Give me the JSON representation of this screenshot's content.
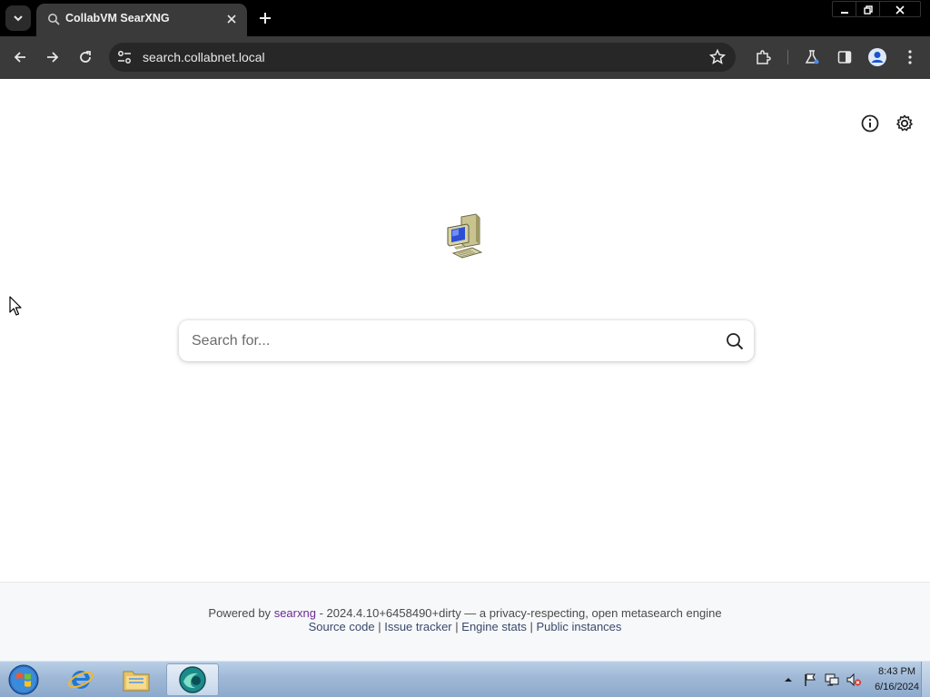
{
  "browser": {
    "tab": {
      "title": "CollabVM SearXNG"
    },
    "address": {
      "url": "search.collabnet.local"
    }
  },
  "page": {
    "search": {
      "placeholder": "Search for..."
    },
    "footer": {
      "powered_prefix": "Powered by",
      "searxng_link": "searxng",
      "version_text": "- 2024.4.10+6458490+dirty — a privacy-respecting, open metasearch engine",
      "links": [
        "Source code",
        "Issue tracker",
        "Engine stats",
        "Public instances"
      ],
      "separator": "|"
    }
  },
  "taskbar": {
    "clock": {
      "time": "8:43 PM",
      "date": "6/16/2024"
    },
    "apps": [
      "internet-explorer-icon",
      "file-explorer-icon",
      "browser-icon"
    ]
  },
  "colors": {
    "tab_bar": "#000000",
    "toolbar": "#3a3a3a",
    "omnibox": "#272727",
    "page_bg": "#ffffff",
    "footer_bg": "#f7f8fa",
    "link_purple": "#6b2b8f",
    "taskbar": "#9fb8d6"
  }
}
